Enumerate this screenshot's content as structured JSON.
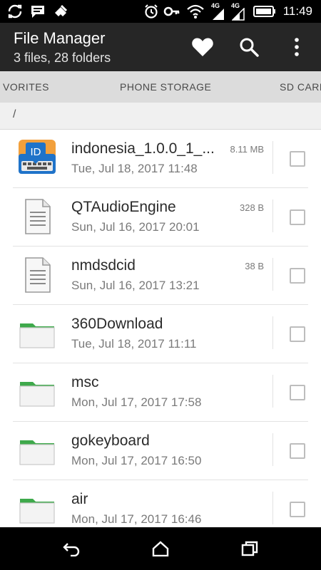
{
  "status_bar": {
    "time": "11:49",
    "network_label_top": "4G",
    "network_label_bottom": "4G",
    "icons": [
      "sync-icon",
      "message-icon",
      "pinned-icon",
      "alarm-icon",
      "key-icon",
      "wifi-hotspot-icon",
      "signal-icon",
      "signal-icon",
      "battery-icon"
    ]
  },
  "app_bar": {
    "title": "File Manager",
    "subtitle": "3 files, 28 folders",
    "actions": [
      "favorite-icon",
      "search-icon",
      "more-icon"
    ]
  },
  "tabs": [
    {
      "label": "VORITES"
    },
    {
      "label": "PHONE STORAGE"
    },
    {
      "label": "SD CARD"
    }
  ],
  "path": "/",
  "files": [
    {
      "name": "indonesia_1.0.0_1_...",
      "date": "Tue, Jul 18, 2017 11:48",
      "size": "8.11 MB",
      "icon": "app-keyboard-icon"
    },
    {
      "name": "QTAudioEngine",
      "date": "Sun, Jul 16, 2017 20:01",
      "size": "328 B",
      "icon": "file-icon"
    },
    {
      "name": "nmdsdcid",
      "date": "Sun, Jul 16, 2017 13:21",
      "size": "38 B",
      "icon": "file-icon"
    },
    {
      "name": "360Download",
      "date": "Tue, Jul 18, 2017 11:11",
      "size": "",
      "icon": "folder-icon"
    },
    {
      "name": "msc",
      "date": "Mon, Jul 17, 2017 17:58",
      "size": "",
      "icon": "folder-icon"
    },
    {
      "name": "gokeyboard",
      "date": "Mon, Jul 17, 2017 16:50",
      "size": "",
      "icon": "folder-icon"
    },
    {
      "name": "air",
      "date": "Mon, Jul 17, 2017 16:46",
      "size": "",
      "icon": "folder-icon"
    }
  ],
  "app_icon_label": "ID",
  "colors": {
    "app_bar": "#262626",
    "tabs_bg": "#dcdcdc",
    "folder_green": "#3ea94b",
    "keyboard_blue": "#1f73c9",
    "keyboard_orange": "#f2a03c"
  }
}
